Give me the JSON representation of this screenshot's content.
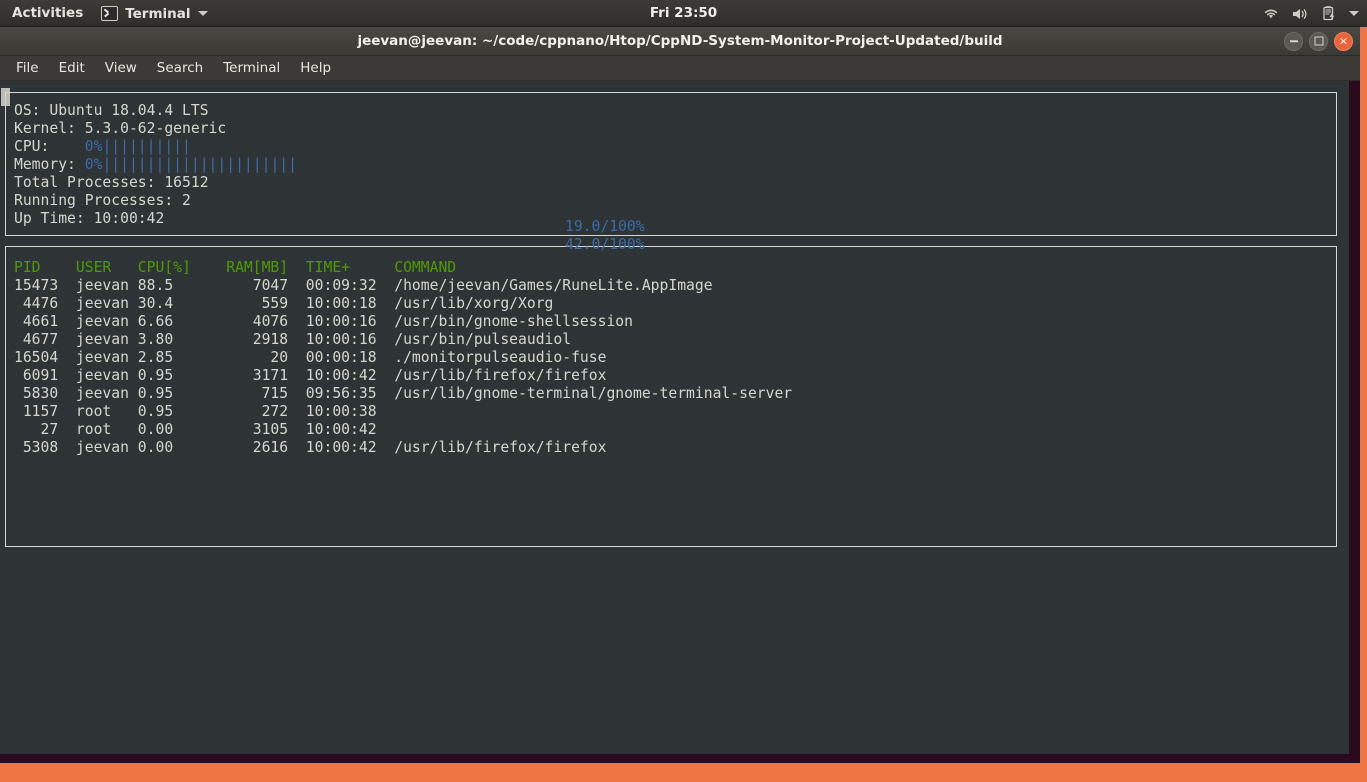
{
  "topbar": {
    "activities": "Activities",
    "app_name": "Terminal",
    "app_icon": "terminal-icon",
    "menu_caret_icon": "chevron-down-icon",
    "clock": "Fri 23:50",
    "tray": [
      {
        "icon": "wifi-icon",
        "name": "network-indicator"
      },
      {
        "icon": "volume-icon",
        "name": "volume-indicator"
      },
      {
        "icon": "battery-icon",
        "name": "battery-indicator"
      },
      {
        "icon": "chevron-down-icon",
        "name": "system-menu-toggle"
      }
    ]
  },
  "window": {
    "title": "jeevan@jeevan: ~/code/cppnano/Htop/CppND-System-Monitor-Project-Updated/build",
    "buttons": {
      "minimize": "minimize-button",
      "maximize": "maximize-button",
      "close_glyph": "×"
    }
  },
  "menubar": {
    "items": [
      "File",
      "Edit",
      "View",
      "Search",
      "Terminal",
      "Help"
    ]
  },
  "system_panel": {
    "os_label": "OS: ",
    "os_value": "Ubuntu 18.04.4 LTS",
    "kernel_label": "Kernel: ",
    "kernel_value": "5.3.0-62-generic",
    "cpu_label": "CPU:    ",
    "cpu_bar_prefix": "0%",
    "cpu_bar": "||||||||||",
    "cpu_usage": "19.0/100%",
    "memory_label": "Memory: ",
    "memory_bar_prefix": "0%",
    "memory_bar": "||||||||||||||||||||||",
    "memory_usage": "42.0/100%",
    "total_processes_label": "Total Processes: ",
    "total_processes_value": "16512",
    "running_processes_label": "Running Processes: ",
    "running_processes_value": "2",
    "uptime_label": "Up Time: ",
    "uptime_value": "10:00:42"
  },
  "process_panel": {
    "header": "PID    USER   CPU[%]    RAM[MB]  TIME+     COMMAND",
    "rows": [
      "15473  jeevan 88.5         7047  00:09:32  /home/jeevan/Games/RuneLite.AppImage",
      " 4476  jeevan 30.4          559  10:00:18  /usr/lib/xorg/Xorg",
      " 4661  jeevan 6.66         4076  10:00:16  /usr/bin/gnome-shellsession",
      " 4677  jeevan 3.80         2918  10:00:16  /usr/bin/pulseaudiol",
      "16504  jeevan 2.85           20  00:00:18  ./monitorpulseaudio-fuse",
      " 6091  jeevan 0.95         3171  10:00:42  /usr/lib/firefox/firefox",
      " 5830  jeevan 0.95          715  09:56:35  /usr/lib/gnome-terminal/gnome-terminal-server",
      " 1157  root   0.95          272  10:00:38  ",
      "   27  root   0.00         3105  10:00:42  ",
      " 5308  jeevan 0.00         2616  10:00:42  /usr/lib/firefox/firefox"
    ]
  },
  "colors": {
    "terminal_bg": "#2e3436",
    "desktop_orange": "#ed7543",
    "header_green": "#4e9a06",
    "accent_blue": "#3c6ba5",
    "text_gray": "#d3d7cf"
  }
}
